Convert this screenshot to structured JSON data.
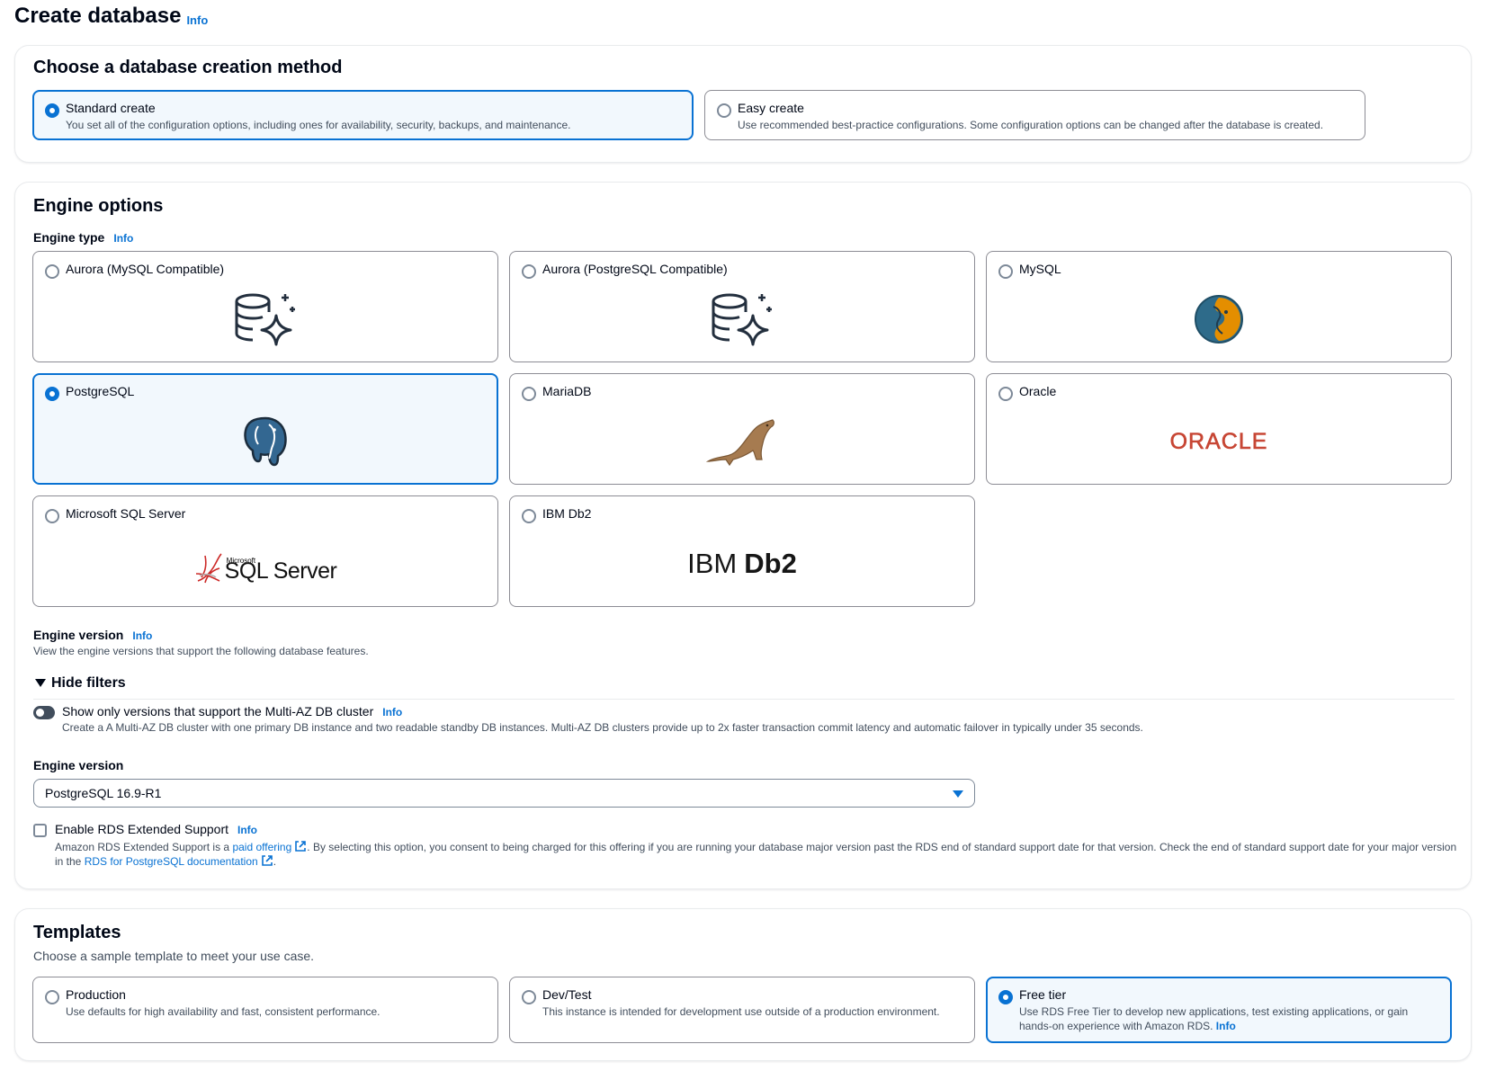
{
  "header": {
    "title": "Create database",
    "info": "Info"
  },
  "method": {
    "heading": "Choose a database creation method",
    "options": [
      {
        "label": "Standard create",
        "description": "You set all of the configuration options, including ones for availability, security, backups, and maintenance.",
        "selected": true
      },
      {
        "label": "Easy create",
        "description": "Use recommended best-practice configurations. Some configuration options can be changed after the database is created.",
        "selected": false
      }
    ]
  },
  "engine": {
    "heading": "Engine options",
    "type_label": "Engine type",
    "info": "Info",
    "options": [
      {
        "label": "Aurora (MySQL Compatible)",
        "logo": "aurora-database-sparkle-icon",
        "selected": false
      },
      {
        "label": "Aurora (PostgreSQL Compatible)",
        "logo": "aurora-database-sparkle-icon",
        "selected": false
      },
      {
        "label": "MySQL",
        "logo": "mysql-dolphin-icon",
        "selected": false
      },
      {
        "label": "PostgreSQL",
        "logo": "postgresql-elephant-icon",
        "selected": true
      },
      {
        "label": "MariaDB",
        "logo": "mariadb-seal-icon",
        "selected": false
      },
      {
        "label": "Oracle",
        "logo": "oracle-wordmark",
        "selected": false
      },
      {
        "label": "Microsoft SQL Server",
        "logo": "sql-server-logo",
        "selected": false
      },
      {
        "label": "IBM Db2",
        "logo": "ibm-db2-wordmark",
        "selected": false
      }
    ],
    "logo_text": {
      "oracle": "ORACLE",
      "sql_small": "Microsoft",
      "sql_big": "SQL Server",
      "ibm": "IBM",
      "db2": "Db2"
    },
    "version_label": "Engine version",
    "version_info": "Info",
    "version_desc": "View the engine versions that support the following database features.",
    "filters_label": "Hide filters",
    "multi_az_label": "Show only versions that support the Multi-AZ DB cluster",
    "multi_az_info": "Info",
    "multi_az_desc": "Create a A Multi-AZ DB cluster with one primary DB instance and two readable standby DB instances. Multi-AZ DB clusters provide up to 2x faster transaction commit latency and automatic failover in typically under 35 seconds.",
    "multi_az_enabled": false,
    "version_select_label": "Engine version",
    "version_value": "PostgreSQL 16.9-R1",
    "extended_label": "Enable RDS Extended Support",
    "extended_info": "Info",
    "extended_checked": false,
    "extended_desc_1": "Amazon RDS Extended Support is a ",
    "extended_link_1": "paid offering",
    "extended_desc_2": ". By selecting this option, you consent to being charged for this offering if you are running your database major version past the RDS end of standard support date for that version. Check the end of standard support date for your major version in the ",
    "extended_link_2": "RDS for PostgreSQL documentation",
    "extended_desc_3": "."
  },
  "templates": {
    "heading": "Templates",
    "description": "Choose a sample template to meet your use case.",
    "options": [
      {
        "label": "Production",
        "description": "Use defaults for high availability and fast, consistent performance.",
        "selected": false
      },
      {
        "label": "Dev/Test",
        "description": "This instance is intended for development use outside of a production environment.",
        "selected": false
      },
      {
        "label": "Free tier",
        "description": "Use RDS Free Tier to develop new applications, test existing applications, or gain hands-on experience with Amazon RDS. ",
        "info": "Info",
        "selected": true
      }
    ]
  },
  "colors": {
    "accent": "#0972d3",
    "selected_bg": "#f2f8fd",
    "text": "#000716",
    "muted": "#414d5c",
    "oracle_red": "#c74634"
  }
}
